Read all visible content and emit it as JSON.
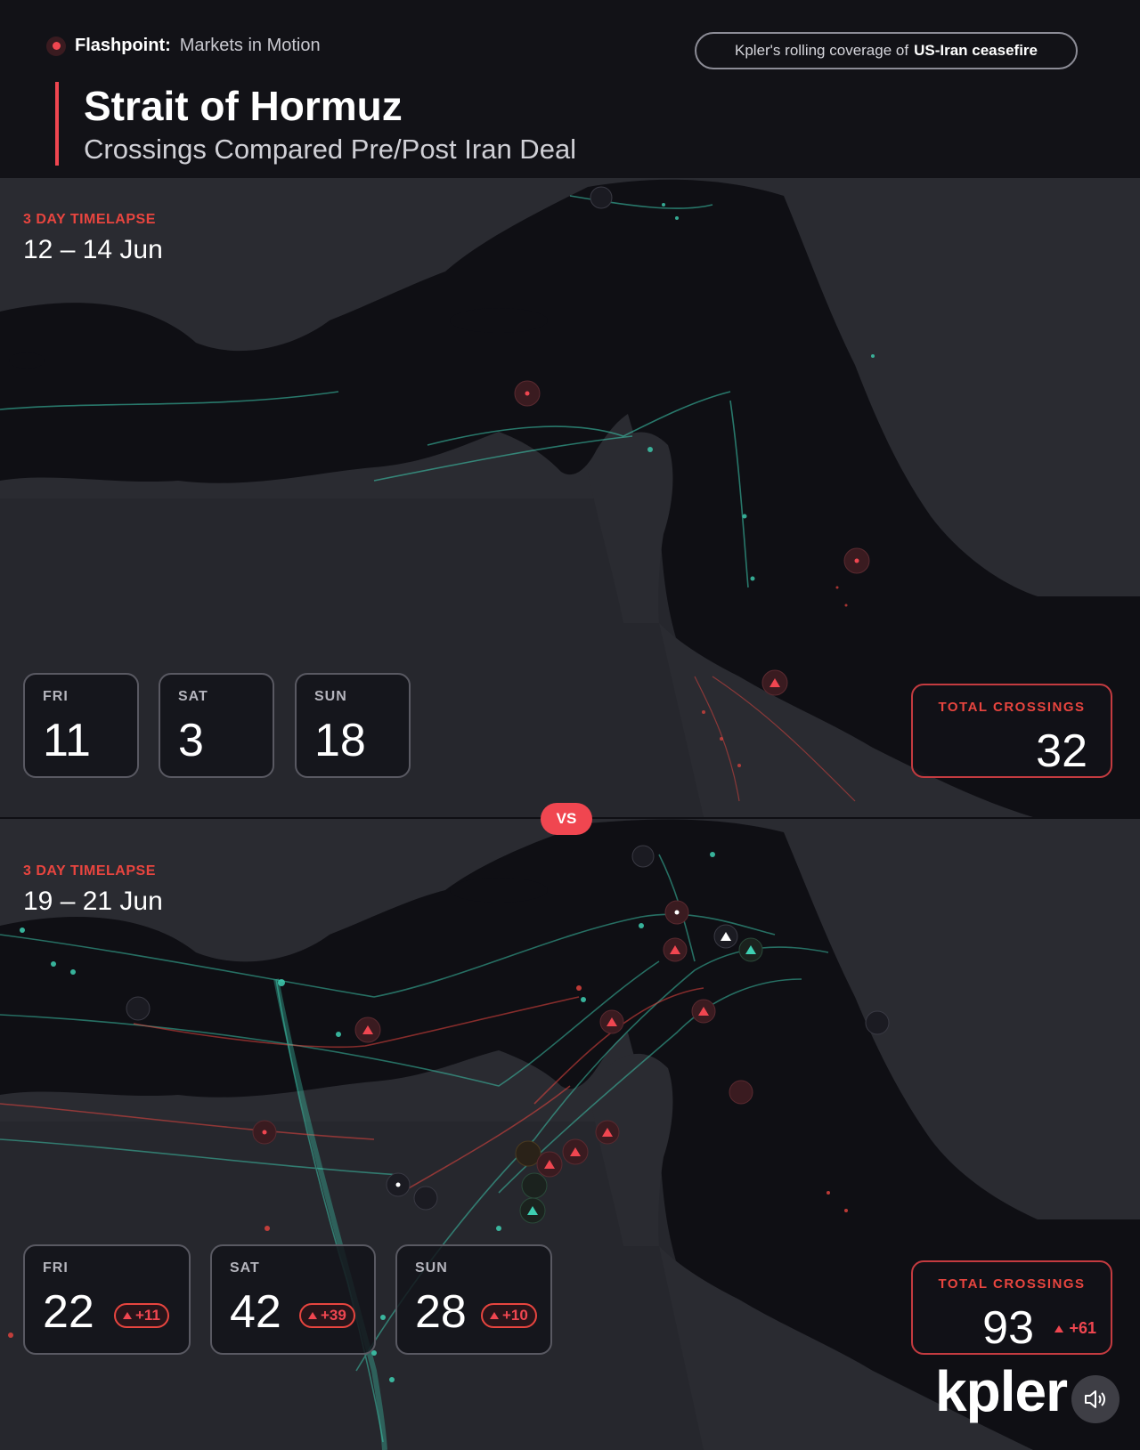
{
  "header": {
    "brand_bold": "Flashpoint:",
    "brand_light": "Markets in Motion",
    "pill_prefix": "Kpler's rolling coverage of",
    "pill_bold": "US-Iran ceasefire",
    "title": "Strait of Hormuz",
    "subtitle": "Crossings Compared Pre/Post Iran Deal"
  },
  "colors": {
    "accent": "#f04650",
    "teal_track": "#3ecfb2",
    "red_track": "#e8453f",
    "land": "#2a2b31",
    "sea": "#0f0f14"
  },
  "vs_label": "VS",
  "periods": [
    {
      "timelapse_label": "3 DAY TIMELAPSE",
      "date_range": "12 – 14 Jun",
      "days": [
        {
          "name": "FRI",
          "value": "11"
        },
        {
          "name": "SAT",
          "value": "3"
        },
        {
          "name": "SUN",
          "value": "18"
        }
      ],
      "total_label": "TOTAL CROSSINGS",
      "total_value": "32"
    },
    {
      "timelapse_label": "3 DAY TIMELAPSE",
      "date_range": "19 – 21 Jun",
      "days": [
        {
          "name": "FRI",
          "value": "22",
          "delta": "+11"
        },
        {
          "name": "SAT",
          "value": "42",
          "delta": "+39"
        },
        {
          "name": "SUN",
          "value": "28",
          "delta": "+10"
        }
      ],
      "total_label": "TOTAL CROSSINGS",
      "total_value": "93",
      "total_delta": "+61"
    }
  ],
  "logo": "kpler",
  "icons": [
    "flashpoint-dot-icon",
    "up-arrow-icon",
    "speaker-icon"
  ]
}
